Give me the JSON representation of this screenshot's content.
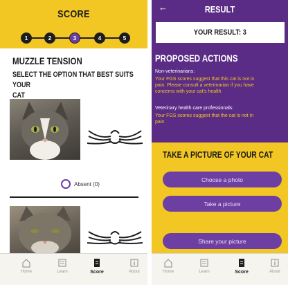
{
  "left": {
    "header_title": "SCORE",
    "steps": [
      "1",
      "2",
      "3",
      "4",
      "5"
    ],
    "section_title": "MUZZLE TENSION",
    "instruction_line1": "SELECT THE OPTION THAT BEST SUITS YOUR",
    "instruction_line2": "CAT",
    "option_label": "Absent (0)"
  },
  "right": {
    "back_glyph": "←",
    "header_title": "RESULT",
    "result_text": "YOUR RESULT: 3",
    "proposed_title": "PROPOSED ACTIONS",
    "nonvet_title": "Non-veterinarians:",
    "nonvet_lines": [
      "Your FGS scores suggest that this cat is not in",
      "pain. Please consult a veterinarian if you have",
      "concerns with your cat's health"
    ],
    "vet_title": "Veterinary health care professionals:",
    "vet_lines": [
      "Your FGS scores suggest that the cat is not in",
      "pain"
    ],
    "take_title": "TAKE A PICTURE OF YOUR CAT",
    "choose_button": "Choose a photo",
    "take_button": "Take a picture",
    "share_button": "Share your picture"
  },
  "tabs": {
    "home": "Home",
    "learn": "Learn",
    "score": "Score",
    "about": "About"
  },
  "colors": {
    "purple": "#5b2c86",
    "button_purple": "#6d3fa3",
    "yellow": "#f2c623"
  }
}
